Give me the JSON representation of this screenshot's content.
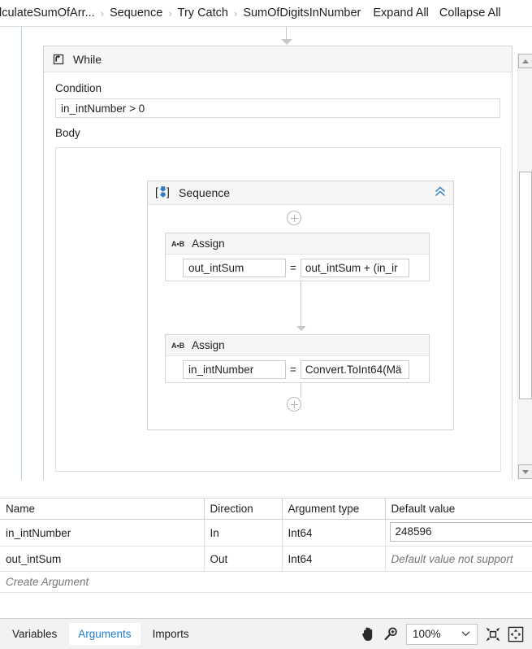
{
  "breadcrumb": {
    "items": [
      {
        "label": "lculateSumOfArr...",
        "name": "breadcrumb-item-calculate-sum-of-array"
      },
      {
        "label": "Sequence",
        "name": "breadcrumb-item-sequence"
      },
      {
        "label": "Try Catch",
        "name": "breadcrumb-item-try-catch"
      },
      {
        "label": "SumOfDigitsInNumber",
        "name": "breadcrumb-item-sum-of-digits-in-number"
      }
    ],
    "separator": "›",
    "expand_all_label": "Expand All",
    "collapse_all_label": "Collapse All"
  },
  "designer": {
    "while": {
      "title": "While",
      "icon": "while-loop-icon",
      "condition_label": "Condition",
      "condition_value": "in_intNumber > 0",
      "body_label": "Body"
    },
    "sequence": {
      "title": "Sequence",
      "icon": "sequence-icon",
      "collapse_icon": "chevron-double-up-icon",
      "collapse_glyph": "«"
    },
    "add_button_glyph": "+",
    "assign_activities": [
      {
        "title": "Assign",
        "icon_label": "A•B",
        "to": "out_intSum",
        "operator": "=",
        "value": "out_intSum + (in_ir"
      },
      {
        "title": "Assign",
        "icon_label": "A•B",
        "to": "in_intNumber",
        "operator": "=",
        "value": "Convert.ToInt64(Mä"
      }
    ]
  },
  "arguments_panel": {
    "columns": [
      "Name",
      "Direction",
      "Argument type",
      "Default value"
    ],
    "rows": [
      {
        "name": "in_intNumber",
        "direction": "In",
        "type": "Int64",
        "default_value": "248596",
        "default_is_placeholder": false
      },
      {
        "name": "out_intSum",
        "direction": "Out",
        "type": "Int64",
        "default_value": "Default value not support",
        "default_is_placeholder": true
      }
    ],
    "create_argument_label": "Create Argument"
  },
  "status_bar": {
    "tabs": [
      {
        "label": "Variables",
        "active": false
      },
      {
        "label": "Arguments",
        "active": true
      },
      {
        "label": "Imports",
        "active": false
      }
    ],
    "pan_icon": "hand-pan-icon",
    "zoom_icon": "magnifier-icon",
    "zoom_level": "100%",
    "zoom_chevron": "⌄",
    "fit_to_screen_icon": "fit-to-screen-icon",
    "overview_icon": "overview-fit-icon"
  },
  "colors": {
    "accent_blue": "#1c7ed6",
    "icon_blue": "#2d7dc4",
    "guide_line": "#afd7ef",
    "panel_header": "#f6f6f6",
    "border": "#d4d4d4"
  }
}
